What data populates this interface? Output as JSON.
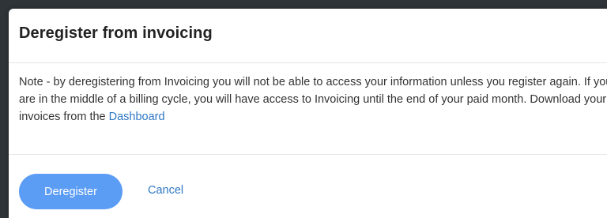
{
  "dialog": {
    "title": "Deregister from invoicing",
    "body": {
      "text": "Note - by deregistering from Invoicing you will not be able to access your information unless you register again. If you are in the middle of a billing cycle, you will have access to Invoicing until the end of your paid month. Download your invoices from the ",
      "link_label": "Dashboard"
    },
    "primary_button_label": "Deregister",
    "cancel_label": "Cancel"
  },
  "colors": {
    "primary": "#5b9cf5",
    "link": "#2f78c4"
  }
}
